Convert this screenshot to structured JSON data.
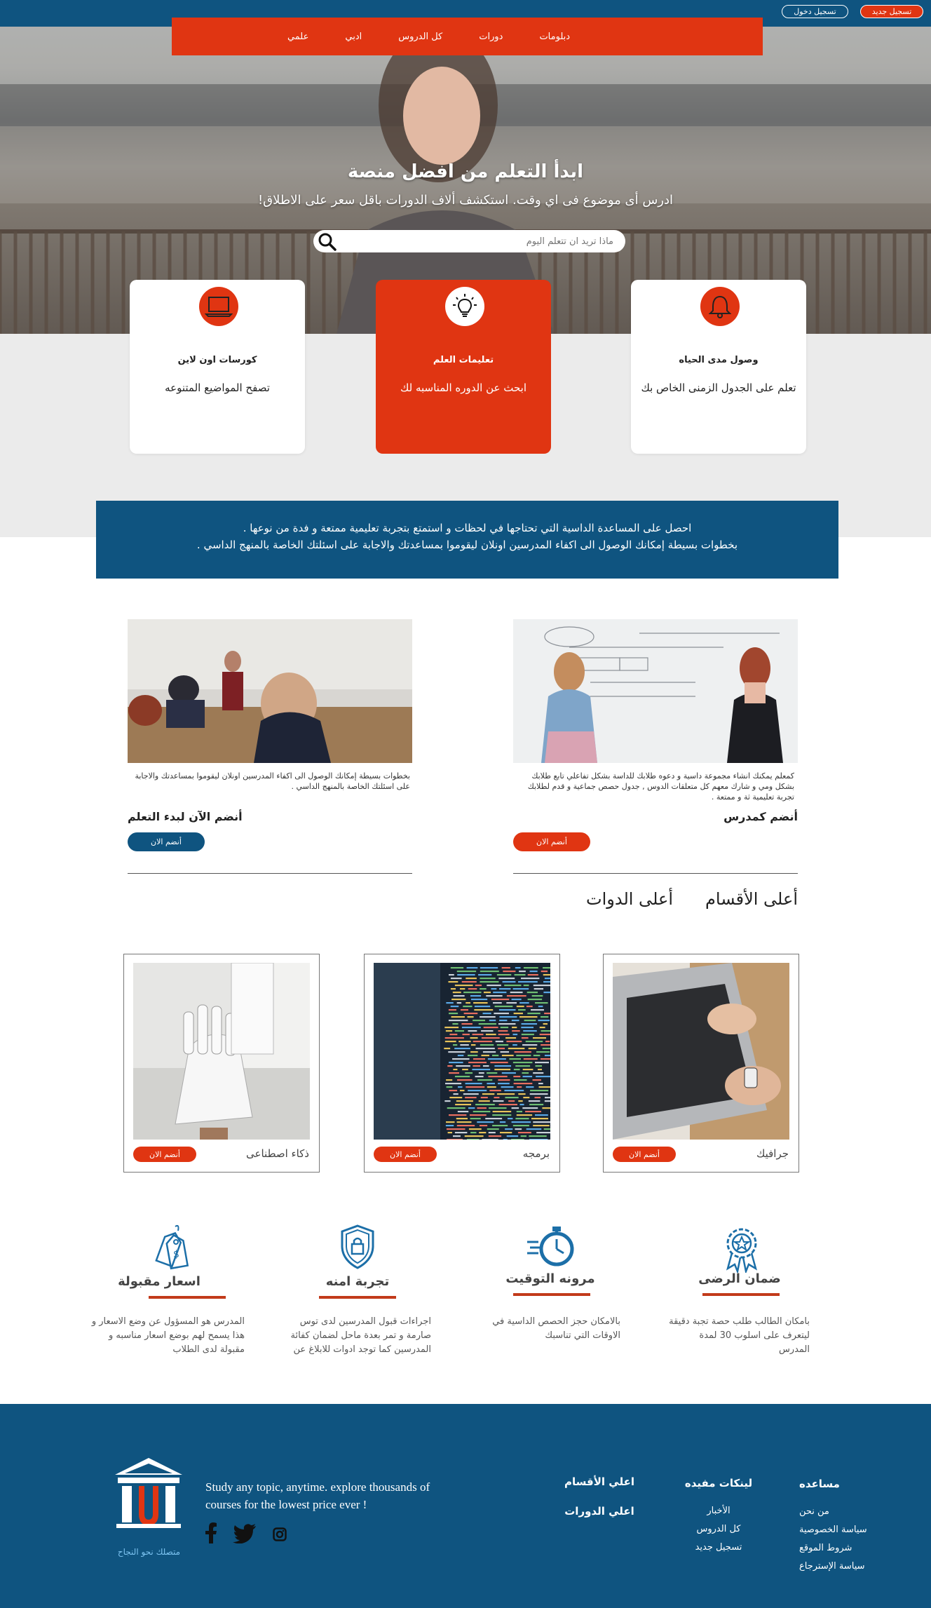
{
  "topbar": {
    "register": "تسجيل جديد",
    "login": "تسجيل دخول"
  },
  "nav": {
    "items": [
      "دبلومات",
      "دورات",
      "كل الدروس",
      "ادبي",
      "علمي"
    ]
  },
  "hero": {
    "title": "ابدأ التعلم من افضل منصة",
    "subtitle": "ادرس أى موضوع فى اي وقت. استكشف ألاف الدورات باقل سعر على الاطلاق!",
    "search_placeholder": "ماذا تريد ان تتعلم اليوم"
  },
  "features": [
    {
      "icon": "bell-icon",
      "title": "وصول مدى الحياه",
      "text": "تعلم على الجدول الزمنى الخاص بك"
    },
    {
      "icon": "lightbulb-icon",
      "title": "تعليمات العلم",
      "text": "ابحث عن الدوره المناسبه لك"
    },
    {
      "icon": "laptop-icon",
      "title": "كورسات اون لاين",
      "text": "تصفح المواضيع المتنوعه"
    }
  ],
  "banner": {
    "line1": "احصل على المساعدة الداسية التي تحتاجها في لحظات و استمتع بتجربة تعليمية ممتعة و فدة من نوعها .",
    "line2": "بخطوات بسيطة إمكانك الوصول الى اكفاء المدرسين اونلان ليقوموا بمساعدتك والاجابة على اسئلتك الخاصة بالمنهج الداسي ."
  },
  "join": [
    {
      "image": "teachers-whiteboard-photo",
      "text": "كمعلم يمكنك انشاء مجموعة داسية و دعوه طلابك للداسة بشكل تفاعلي تابع طلابك بشكل ومي و شارك معهم كل متعلقات الدوس , جدول حصص جماعية و قدم لطلابك تجربة تعليمية ثة و ممتعة .",
      "title": "أنضم كمدرس",
      "button": "أنضم الان",
      "color": "#e03512"
    },
    {
      "image": "classroom-photo",
      "text": "بخطوات بسيطة إمكانك الوصول الى اكفاء المدرسين اونلان ليقوموا بمساعدتك والاجابة على اسئلتك الخاصة بالمنهج الداسي .",
      "title": "أنضم الآن لبدء التعلم",
      "button": "أنضم الان",
      "color": "#0f5480"
    }
  ],
  "section_tabs": [
    "أعلى الأقسام",
    "أعلى الدوات"
  ],
  "categories": [
    {
      "image": "laptop-typing-photo",
      "name": "جرافيك",
      "button": "أنضم الان"
    },
    {
      "image": "code-screen-photo",
      "name": "برمجه",
      "button": "أنضم الان"
    },
    {
      "image": "robot-hand-photo",
      "name": "ذكاء اصطناعى",
      "button": "أنضم الان"
    }
  ],
  "benefits": [
    {
      "icon": "award-ribbon-icon",
      "title": "ضمان الرضى",
      "text": "بامكان الطالب طلب حصة تجبة دقيقة ليتعرف على اسلوب 30 لمدة المدرس"
    },
    {
      "icon": "stopwatch-icon",
      "title": "مرونه التوقيت",
      "text": "بالامكان حجز الحصص الداسية في الاوقات التي تناسبك"
    },
    {
      "icon": "shield-lock-icon",
      "title": "تجربة امنه",
      "text": "اجراءات قبول المدرسين لدى توس صارمة و تمر بعدة ماحل لضمان كفائة المدرسين كما توجد ادوات للابلاغ عن"
    },
    {
      "icon": "price-tag-icon",
      "title": "اسعار مقبولة",
      "text": "المدرس هو المسؤول عن وضع الاسعار و هذا يسمح لهم بوضع اسعار مناسبه و مقبولة لدى الطلاب"
    }
  ],
  "footer": {
    "tagline": "متصلك نحو النجاح",
    "about": "Study any topic, anytime. explore thousands of courses for the lowest price ever !",
    "columns": [
      {
        "title": "مساعده",
        "links": [
          "من نحن",
          "سياسة الخصوصية",
          "شروط الموقع",
          "سياسة الإسترجاع"
        ]
      },
      {
        "title": "لينكات مفيده",
        "links": [
          "الأخبار",
          "كل الدروس",
          "تسجيل جديد"
        ]
      },
      {
        "title": "اعلي الأقسام",
        "links": []
      },
      {
        "title": "اعلي الدورات",
        "links": []
      }
    ],
    "social_icons": [
      "instagram-icon",
      "twitter-icon",
      "facebook-icon"
    ]
  },
  "colors": {
    "primary": "#0f5480",
    "accent": "#e03512",
    "light_bg": "#ebebeb"
  }
}
